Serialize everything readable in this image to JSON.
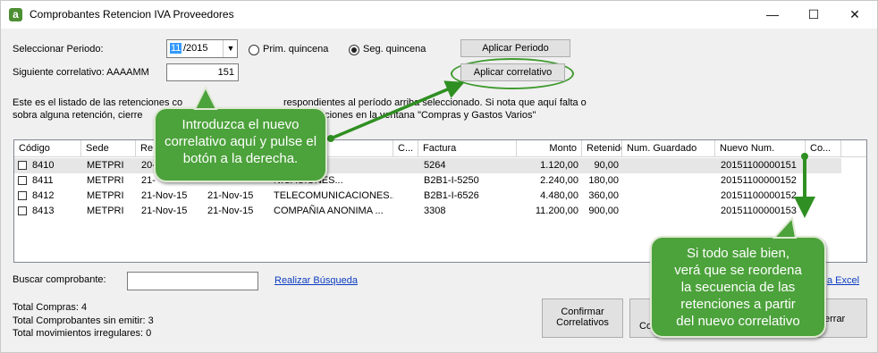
{
  "window": {
    "title": "Comprobantes Retencion IVA Proveedores",
    "app_icon_letter": "a",
    "minimize_glyph": "—",
    "maximize_glyph": "☐",
    "close_glyph": "✕"
  },
  "period": {
    "label": "Seleccionar Periodo:",
    "month_selected": "11",
    "year_part": "/2015",
    "radio1_label": "Prim. quincena",
    "radio2_label": "Seg. quincena",
    "selected_radio": "Seg. quincena",
    "apply_period_label": "Aplicar Periodo"
  },
  "correlativo": {
    "label": "Siguiente correlativo: AAAAMM",
    "value": "151",
    "apply_label": "Aplicar correlativo"
  },
  "info": {
    "line1_left": "Este es el listado de las retenciones co",
    "line1_right": "respondientes al período arriba seleccionado. Si nota que aquí falta o",
    "line2_left": "sobra alguna retención, cierre",
    "line2_right": "aciones en la ventana \"Compras y Gastos Varios\""
  },
  "table": {
    "headers": [
      "Código",
      "Sede",
      "Re",
      "",
      "",
      "C...",
      "Factura",
      "Monto",
      "Retenido",
      "Num. Guardado",
      "Nuevo Num.",
      "Co..."
    ],
    "rows": [
      {
        "codigo": "8410",
        "sede": "METPRI",
        "fecha1": "20-",
        "fecha2": "",
        "proveedor": "LAR, C.A",
        "c": "",
        "factura": "5264",
        "monto": "1.120,00",
        "retenido": "90,00",
        "guardado": "",
        "nuevo": "20151100000151"
      },
      {
        "codigo": "8411",
        "sede": "METPRI",
        "fecha1": "21-",
        "fecha2": "",
        "proveedor": "NICACIONES...",
        "c": "",
        "factura": "B2B1-I-5250",
        "monto": "2.240,00",
        "retenido": "180,00",
        "guardado": "",
        "nuevo": "20151100000152"
      },
      {
        "codigo": "8412",
        "sede": "METPRI",
        "fecha1": "21-Nov-15",
        "fecha2": "21-Nov-15",
        "proveedor": "TELECOMUNICACIONES...",
        "c": "",
        "factura": "B2B1-I-6526",
        "monto": "4.480,00",
        "retenido": "360,00",
        "guardado": "",
        "nuevo": "20151100000152"
      },
      {
        "codigo": "8413",
        "sede": "METPRI",
        "fecha1": "21-Nov-15",
        "fecha2": "21-Nov-15",
        "proveedor": "COMPAÑIA ANONIMA ...",
        "c": "",
        "factura": "3308",
        "monto": "11.200,00",
        "retenido": "900,00",
        "guardado": "",
        "nuevo": "20151100000153"
      }
    ]
  },
  "search": {
    "label": "Buscar comprobante:",
    "value": "",
    "link_label": "Realizar Búsqueda",
    "excel_link_fragment": "a Excel"
  },
  "totals": {
    "compras": "Total Compras: 4",
    "sin_emitir": "Total Comprobantes sin emitir: 3",
    "irregulares": "Total movimientos irregulares: 0"
  },
  "buttons": {
    "confirmar_line1": "Confirmar",
    "confirmar_line2": "Correlativos",
    "partial_btn2": "Com",
    "cerrar_partial": "errar"
  },
  "callouts": {
    "left_line1": "Introduzca el nuevo",
    "left_line2": "correlativo aquí y pulse el",
    "left_line3": "botón a la derecha.",
    "right_line1": "Si todo sale bien,",
    "right_line2": "verá que se reordena",
    "right_line3": "la secuencia de las",
    "right_line4": "retenciones a partir",
    "right_line5": "del nuevo correlativo"
  },
  "colors": {
    "annotation_green": "#4ca23b",
    "link_blue": "#0b3cc1",
    "highlight_row": "#e6e6e6"
  }
}
